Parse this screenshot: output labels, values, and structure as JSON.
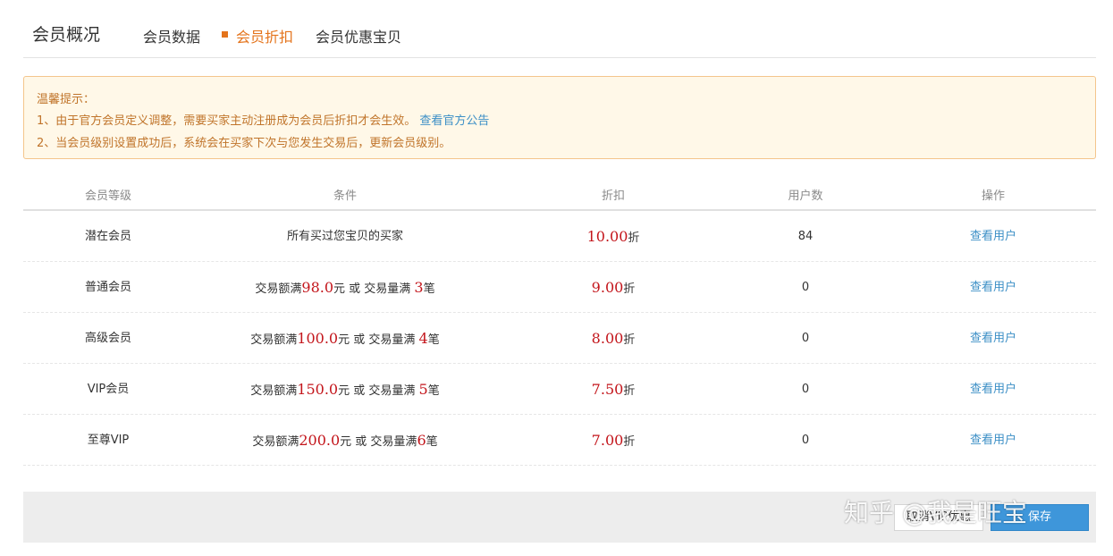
{
  "header": {
    "title": "会员概况",
    "tabs": [
      {
        "label": "会员数据"
      },
      {
        "label": "会员折扣"
      },
      {
        "label": "会员优惠宝贝"
      }
    ],
    "active_tab_color": "#e4741c"
  },
  "notice": {
    "title": "温馨提示：",
    "line1": "1、由于官方会员定义调整，需要买家主动注册成为会员后折扣才会生效。",
    "line1_link": "查看官方公告",
    "line2": "2、当会员级别设置成功后，系统会在买家下次与您发生交易后，更新会员级别。"
  },
  "table": {
    "columns": [
      "会员等级",
      "条件",
      "折扣",
      "用户数",
      "操作"
    ],
    "rows": [
      {
        "level": "潜在会员",
        "condition": "所有买过您宝贝的买家",
        "discount": "10.00",
        "discount_unit": "折",
        "users": "84",
        "action": "查看用户"
      },
      {
        "level": "普通会员",
        "cond_pre": "交易额满",
        "amount": "98.0",
        "cond_mid": "元 或 交易量满 ",
        "count": "3",
        "cond_post": "笔",
        "discount": "9.00",
        "discount_unit": "折",
        "users": "0",
        "action": "查看用户"
      },
      {
        "level": "高级会员",
        "cond_pre": "交易额满",
        "amount": "100.0",
        "cond_mid": "元 或 交易量满 ",
        "count": "4",
        "cond_post": "笔",
        "discount": "8.00",
        "discount_unit": "折",
        "users": "0",
        "action": "查看用户"
      },
      {
        "level": "VIP会员",
        "cond_pre": "交易额满",
        "amount": "150.0",
        "cond_mid": "元 或 交易量满 ",
        "count": "5",
        "cond_post": "笔",
        "discount": "7.50",
        "discount_unit": "折",
        "users": "0",
        "action": "查看用户"
      },
      {
        "level": "至尊VIP",
        "cond_pre": "交易额满",
        "amount": "200.0",
        "cond_mid": "元 或 交易量满",
        "count": "6",
        "cond_post": "笔",
        "discount": "7.00",
        "discount_unit": "折",
        "users": "0",
        "action": "查看用户"
      }
    ]
  },
  "footer": {
    "cancel_label": "取消VIP优惠",
    "save_label": "保存"
  },
  "watermark": "知乎 @我是旺宝"
}
